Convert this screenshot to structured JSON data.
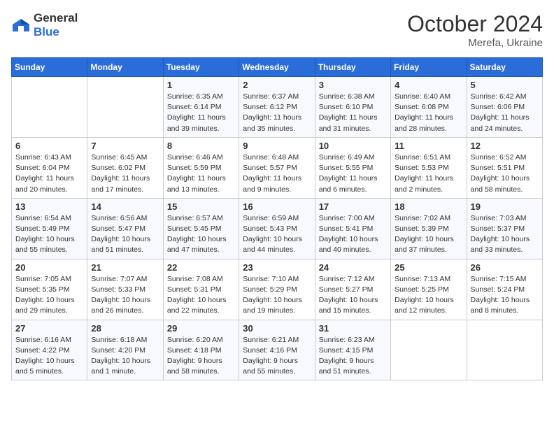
{
  "logo": {
    "general": "General",
    "blue": "Blue"
  },
  "header": {
    "month": "October 2024",
    "location": "Merefa, Ukraine"
  },
  "weekdays": [
    "Sunday",
    "Monday",
    "Tuesday",
    "Wednesday",
    "Thursday",
    "Friday",
    "Saturday"
  ],
  "weeks": [
    [
      {
        "day": "",
        "info": ""
      },
      {
        "day": "",
        "info": ""
      },
      {
        "day": "1",
        "info": "Sunrise: 6:35 AM\nSunset: 6:14 PM\nDaylight: 11 hours and 39 minutes."
      },
      {
        "day": "2",
        "info": "Sunrise: 6:37 AM\nSunset: 6:12 PM\nDaylight: 11 hours and 35 minutes."
      },
      {
        "day": "3",
        "info": "Sunrise: 6:38 AM\nSunset: 6:10 PM\nDaylight: 11 hours and 31 minutes."
      },
      {
        "day": "4",
        "info": "Sunrise: 6:40 AM\nSunset: 6:08 PM\nDaylight: 11 hours and 28 minutes."
      },
      {
        "day": "5",
        "info": "Sunrise: 6:42 AM\nSunset: 6:06 PM\nDaylight: 11 hours and 24 minutes."
      }
    ],
    [
      {
        "day": "6",
        "info": "Sunrise: 6:43 AM\nSunset: 6:04 PM\nDaylight: 11 hours and 20 minutes."
      },
      {
        "day": "7",
        "info": "Sunrise: 6:45 AM\nSunset: 6:02 PM\nDaylight: 11 hours and 17 minutes."
      },
      {
        "day": "8",
        "info": "Sunrise: 6:46 AM\nSunset: 5:59 PM\nDaylight: 11 hours and 13 minutes."
      },
      {
        "day": "9",
        "info": "Sunrise: 6:48 AM\nSunset: 5:57 PM\nDaylight: 11 hours and 9 minutes."
      },
      {
        "day": "10",
        "info": "Sunrise: 6:49 AM\nSunset: 5:55 PM\nDaylight: 11 hours and 6 minutes."
      },
      {
        "day": "11",
        "info": "Sunrise: 6:51 AM\nSunset: 5:53 PM\nDaylight: 11 hours and 2 minutes."
      },
      {
        "day": "12",
        "info": "Sunrise: 6:52 AM\nSunset: 5:51 PM\nDaylight: 10 hours and 58 minutes."
      }
    ],
    [
      {
        "day": "13",
        "info": "Sunrise: 6:54 AM\nSunset: 5:49 PM\nDaylight: 10 hours and 55 minutes."
      },
      {
        "day": "14",
        "info": "Sunrise: 6:56 AM\nSunset: 5:47 PM\nDaylight: 10 hours and 51 minutes."
      },
      {
        "day": "15",
        "info": "Sunrise: 6:57 AM\nSunset: 5:45 PM\nDaylight: 10 hours and 47 minutes."
      },
      {
        "day": "16",
        "info": "Sunrise: 6:59 AM\nSunset: 5:43 PM\nDaylight: 10 hours and 44 minutes."
      },
      {
        "day": "17",
        "info": "Sunrise: 7:00 AM\nSunset: 5:41 PM\nDaylight: 10 hours and 40 minutes."
      },
      {
        "day": "18",
        "info": "Sunrise: 7:02 AM\nSunset: 5:39 PM\nDaylight: 10 hours and 37 minutes."
      },
      {
        "day": "19",
        "info": "Sunrise: 7:03 AM\nSunset: 5:37 PM\nDaylight: 10 hours and 33 minutes."
      }
    ],
    [
      {
        "day": "20",
        "info": "Sunrise: 7:05 AM\nSunset: 5:35 PM\nDaylight: 10 hours and 29 minutes."
      },
      {
        "day": "21",
        "info": "Sunrise: 7:07 AM\nSunset: 5:33 PM\nDaylight: 10 hours and 26 minutes."
      },
      {
        "day": "22",
        "info": "Sunrise: 7:08 AM\nSunset: 5:31 PM\nDaylight: 10 hours and 22 minutes."
      },
      {
        "day": "23",
        "info": "Sunrise: 7:10 AM\nSunset: 5:29 PM\nDaylight: 10 hours and 19 minutes."
      },
      {
        "day": "24",
        "info": "Sunrise: 7:12 AM\nSunset: 5:27 PM\nDaylight: 10 hours and 15 minutes."
      },
      {
        "day": "25",
        "info": "Sunrise: 7:13 AM\nSunset: 5:25 PM\nDaylight: 10 hours and 12 minutes."
      },
      {
        "day": "26",
        "info": "Sunrise: 7:15 AM\nSunset: 5:24 PM\nDaylight: 10 hours and 8 minutes."
      }
    ],
    [
      {
        "day": "27",
        "info": "Sunrise: 6:16 AM\nSunset: 4:22 PM\nDaylight: 10 hours and 5 minutes."
      },
      {
        "day": "28",
        "info": "Sunrise: 6:18 AM\nSunset: 4:20 PM\nDaylight: 10 hours and 1 minute."
      },
      {
        "day": "29",
        "info": "Sunrise: 6:20 AM\nSunset: 4:18 PM\nDaylight: 9 hours and 58 minutes."
      },
      {
        "day": "30",
        "info": "Sunrise: 6:21 AM\nSunset: 4:16 PM\nDaylight: 9 hours and 55 minutes."
      },
      {
        "day": "31",
        "info": "Sunrise: 6:23 AM\nSunset: 4:15 PM\nDaylight: 9 hours and 51 minutes."
      },
      {
        "day": "",
        "info": ""
      },
      {
        "day": "",
        "info": ""
      }
    ]
  ]
}
